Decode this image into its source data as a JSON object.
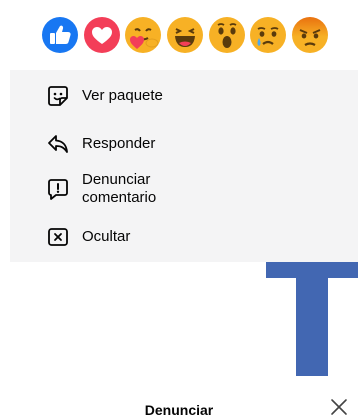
{
  "reactions": [
    {
      "name": "like",
      "icon": "like-icon",
      "color": "#1877F2"
    },
    {
      "name": "love",
      "icon": "love-icon",
      "color": "#F33E58"
    },
    {
      "name": "care",
      "icon": "care-icon",
      "color": "#F7B125"
    },
    {
      "name": "haha",
      "icon": "haha-icon",
      "color": "#F7B125"
    },
    {
      "name": "wow",
      "icon": "wow-icon",
      "color": "#F7B125"
    },
    {
      "name": "sad",
      "icon": "sad-icon",
      "color": "#F7B125"
    },
    {
      "name": "angry",
      "icon": "angry-icon",
      "color": "#E9710F"
    }
  ],
  "menu": {
    "items": [
      {
        "label": "Ver paquete",
        "icon": "sticker-icon"
      },
      {
        "label": "Responder",
        "icon": "reply-icon"
      },
      {
        "label": "Denunciar comentario",
        "icon": "report-icon"
      },
      {
        "label": "Ocultar",
        "icon": "hide-icon"
      }
    ]
  },
  "background_logo": {
    "icon": "facebook-logo-icon",
    "color": "#4267B2"
  },
  "sheet": {
    "title": "Denunciar",
    "close_icon": "close-icon"
  }
}
